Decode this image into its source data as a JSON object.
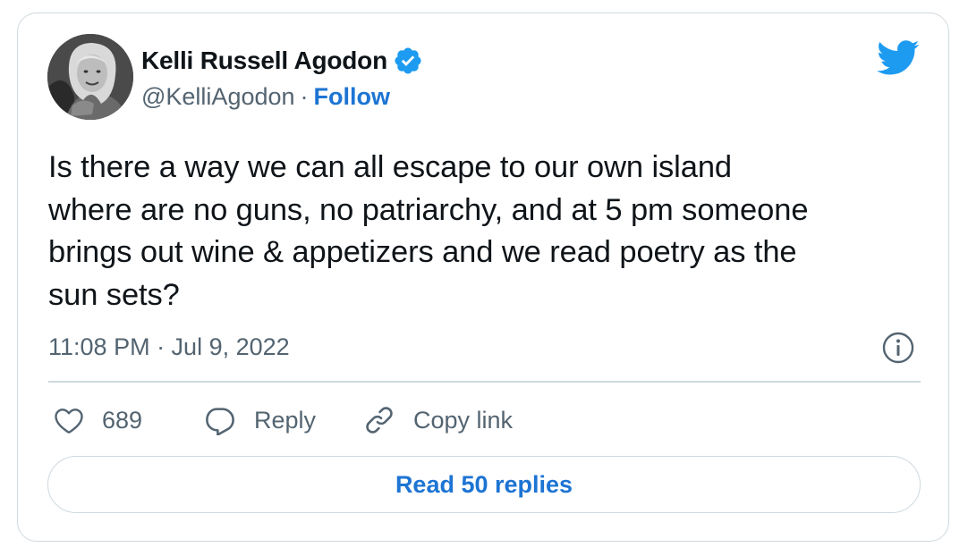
{
  "author": {
    "name": "Kelli Russell Agodon",
    "handle": "@KelliAgodon",
    "separator": "·",
    "follow_label": "Follow",
    "verified_icon": "verified-badge-icon",
    "avatar_icon": "profile-photo"
  },
  "brand": {
    "icon": "twitter-bird-icon",
    "accent_color": "#1d9bf0",
    "link_color": "#1d74d3"
  },
  "tweet": {
    "lines": [
      "Is there a way we can all escape to our own island",
      "where are no guns, no patriarchy, and at 5 pm someone",
      "brings out wine & appetizers and we read poetry as the",
      "sun sets?"
    ],
    "timestamp": "11:08 PM · Jul 9, 2022",
    "info_icon": "info-icon"
  },
  "actions": {
    "like": {
      "icon": "heart-icon",
      "count": "689"
    },
    "reply": {
      "icon": "reply-bubble-icon",
      "label": "Reply"
    },
    "copy": {
      "icon": "link-icon",
      "label": "Copy link"
    }
  },
  "read_replies_label": "Read 50 replies"
}
